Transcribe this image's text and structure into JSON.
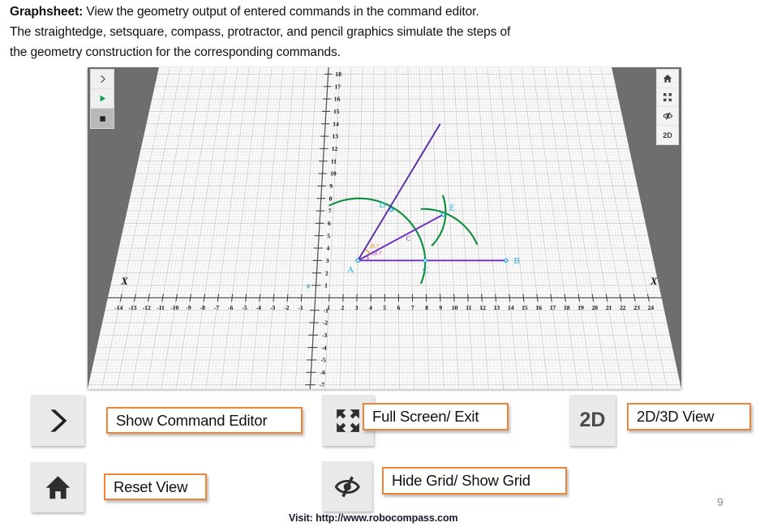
{
  "intro": {
    "label": "Graphsheet:",
    "line1": " View the geometry output of entered commands in the command editor.",
    "line2": "The straightedge, setsquare, compass, protractor, and pencil graphics simulate the steps of",
    "line3": "the geometry construction for the corresponding commands."
  },
  "app": {
    "left_toolbar": [
      {
        "name": "show-command-editor",
        "icon": "chevron-right-icon",
        "label": ""
      },
      {
        "name": "run",
        "icon": "play-icon",
        "label": ""
      },
      {
        "name": "stop",
        "icon": "stop-icon",
        "label": ""
      }
    ],
    "right_toolbar": [
      {
        "name": "reset-view",
        "icon": "home-icon",
        "label": ""
      },
      {
        "name": "full-screen",
        "icon": "fullscreen-icon",
        "label": ""
      },
      {
        "name": "toggle-grid",
        "icon": "hide-grid-icon",
        "label": ""
      },
      {
        "name": "view-mode",
        "icon": "text-icon",
        "label": "2D"
      }
    ]
  },
  "chart_data": {
    "type": "scatter",
    "title": "",
    "xlabel": "X",
    "ylabel": "",
    "xlim": [
      -14.8,
      24.8
    ],
    "ylim": [
      -7,
      18
    ],
    "grid": true,
    "x_ticks": [
      -14,
      -13,
      -12,
      -11,
      -10,
      -9,
      -8,
      -7,
      -6,
      -5,
      -4,
      -3,
      -2,
      -1,
      1,
      2,
      3,
      4,
      5,
      6,
      7,
      8,
      9,
      10,
      11,
      12,
      13,
      14,
      15,
      16,
      17,
      18,
      19,
      20,
      21,
      22,
      23,
      24
    ],
    "y_ticks": [
      18,
      17,
      16,
      15,
      14,
      13,
      12,
      11,
      10,
      9,
      8,
      7,
      6,
      5,
      4,
      3,
      2,
      1,
      -1,
      -2,
      -3,
      -4,
      -5,
      -6,
      -7
    ],
    "origin_label": "0",
    "axis_labels": {
      "left": "X",
      "right": "X"
    },
    "points": [
      {
        "label": "A",
        "x": 3,
        "y": 3
      },
      {
        "label": "B",
        "x": 14,
        "y": 3
      },
      {
        "label": "C",
        "x": 8,
        "y": 3
      },
      {
        "label": "C",
        "x": 6.6,
        "y": 4.6
      },
      {
        "label": "D",
        "x": 5.5,
        "y": 7.1
      },
      {
        "label": "E",
        "x": 9.5,
        "y": 6.7
      }
    ],
    "segments": [
      {
        "name": "AB",
        "from": [
          3,
          3
        ],
        "to": [
          14,
          3
        ],
        "color": "#6A2EC0"
      },
      {
        "name": "AE",
        "from": [
          3,
          3
        ],
        "to": [
          9.5,
          6.7
        ],
        "color": "#6A2EC0"
      },
      {
        "name": "AD-ray",
        "from": [
          3,
          3
        ],
        "to": [
          9.6,
          14
        ],
        "color": "#5B2BA8"
      }
    ],
    "arcs": [
      {
        "name": "arc-from-A",
        "color": "#0C8C3C"
      },
      {
        "name": "arc-from-C",
        "color": "#0C8C3C"
      },
      {
        "name": "arc-from-D",
        "color": "#0C8C3C"
      }
    ],
    "angle_labels": [
      {
        "text": "28.7",
        "color": "#E8940C"
      },
      {
        "text": "28.7",
        "color": "#C83CC8"
      }
    ]
  },
  "legend": [
    {
      "id": "show-command-editor",
      "icon": "chevron-right-icon",
      "icon_text": "",
      "label": "Show Command Editor"
    },
    {
      "id": "full-screen",
      "icon": "fullscreen-icon",
      "icon_text": "",
      "label": "Full Screen/ Exit"
    },
    {
      "id": "view-2d-3d",
      "icon": "text-icon",
      "icon_text": "2D",
      "label": "2D/3D View"
    },
    {
      "id": "reset-view",
      "icon": "home-icon",
      "icon_text": "",
      "label": "Reset View"
    },
    {
      "id": "toggle-grid",
      "icon": "hide-grid-icon",
      "icon_text": "",
      "label": "Hide Grid/ Show Grid"
    }
  ],
  "footer": {
    "visit": "Visit:  http://www.robocompass.com",
    "page": "9"
  },
  "colors": {
    "accent": "#ee8536",
    "line": "#6A2EC0",
    "arc": "#0C8C3C",
    "point": "#21ABDB"
  }
}
